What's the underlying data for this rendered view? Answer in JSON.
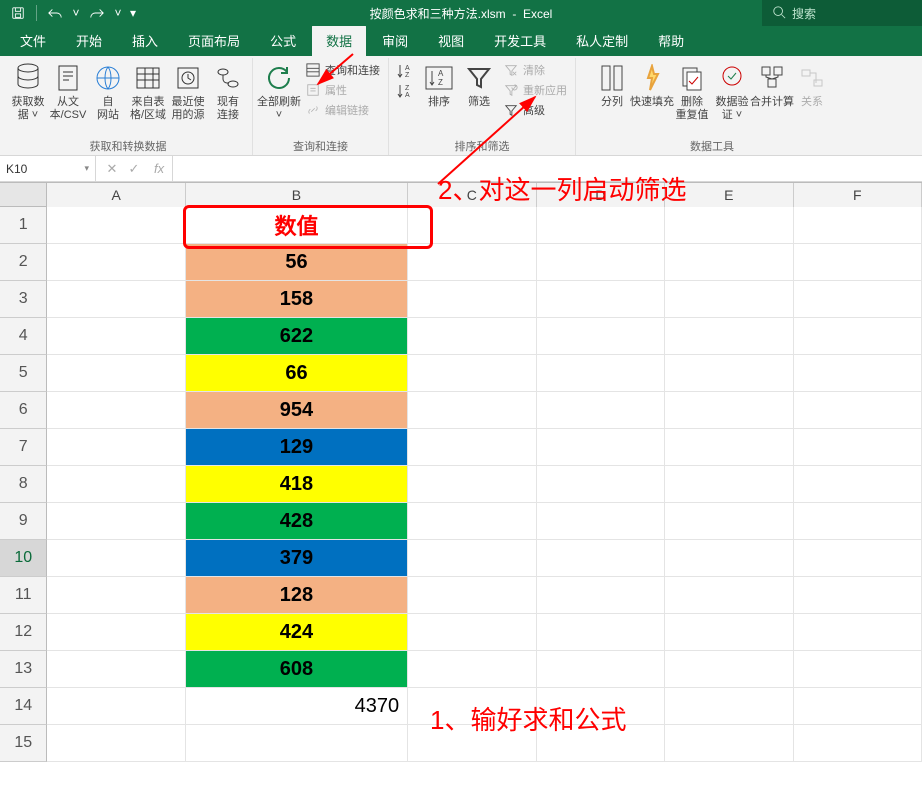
{
  "titlebar": {
    "filename": "按颜色求和三种方法.xlsm",
    "appname": "Excel",
    "search_placeholder": "搜索"
  },
  "menu": {
    "tabs": [
      "文件",
      "开始",
      "插入",
      "页面布局",
      "公式",
      "数据",
      "审阅",
      "视图",
      "开发工具",
      "私人定制",
      "帮助"
    ],
    "active_index": 5
  },
  "ribbon": {
    "groups": {
      "get_transform": {
        "label": "获取和转换数据",
        "buttons": {
          "get_data": "获取数\n据 ˅",
          "from_text": "从文\n本/CSV",
          "from_web": "自\n网站",
          "from_table": "来自表\n格/区域",
          "recent": "最近使\n用的源",
          "existing": "现有\n连接"
        }
      },
      "queries": {
        "label": "查询和连接",
        "refresh_all": "全部刷新\n˅",
        "queries_conn": "查询和连接",
        "properties": "属性",
        "edit_links": "编辑链接"
      },
      "sort_filter": {
        "label": "排序和筛选",
        "sort": "排序",
        "filter": "筛选",
        "clear": "清除",
        "reapply": "重新应用",
        "advanced": "高级"
      },
      "data_tools": {
        "label": "数据工具",
        "text_to_col": "分列",
        "flash_fill": "快速填充",
        "remove_dup": "删除\n重复值",
        "data_valid": "数据验\n证 ˅",
        "consolidate": "合并计算",
        "relations": "关系"
      }
    }
  },
  "namebox": {
    "cell_ref": "K10",
    "fx": "fx"
  },
  "annotations": {
    "a1": "1、输好求和公式",
    "a2": "2、对这一列启动筛选"
  },
  "sheet": {
    "columns": [
      "A",
      "B",
      "C",
      "D",
      "E",
      "F"
    ],
    "row_headers": [
      1,
      2,
      3,
      4,
      5,
      6,
      7,
      8,
      9,
      10,
      11,
      12,
      13,
      14,
      15
    ],
    "header_cell": "数值",
    "rows": [
      {
        "v": "56",
        "c": "orange"
      },
      {
        "v": "158",
        "c": "orange"
      },
      {
        "v": "622",
        "c": "green"
      },
      {
        "v": "66",
        "c": "yellow"
      },
      {
        "v": "954",
        "c": "orange"
      },
      {
        "v": "129",
        "c": "blue"
      },
      {
        "v": "418",
        "c": "yellow"
      },
      {
        "v": "428",
        "c": "green"
      },
      {
        "v": "379",
        "c": "blue"
      },
      {
        "v": "128",
        "c": "orange"
      },
      {
        "v": "424",
        "c": "yellow"
      },
      {
        "v": "608",
        "c": "green"
      }
    ],
    "sum_cell": "4370",
    "selected_row": 10
  },
  "chart_data": {
    "type": "table",
    "title": "数值",
    "categories": [
      "row2",
      "row3",
      "row4",
      "row5",
      "row6",
      "row7",
      "row8",
      "row9",
      "row10",
      "row11",
      "row12",
      "row13"
    ],
    "values": [
      56,
      158,
      622,
      66,
      954,
      129,
      418,
      428,
      379,
      128,
      424,
      608
    ],
    "colors": [
      "orange",
      "orange",
      "green",
      "yellow",
      "orange",
      "blue",
      "yellow",
      "green",
      "blue",
      "orange",
      "yellow",
      "green"
    ],
    "sum": 4370
  }
}
